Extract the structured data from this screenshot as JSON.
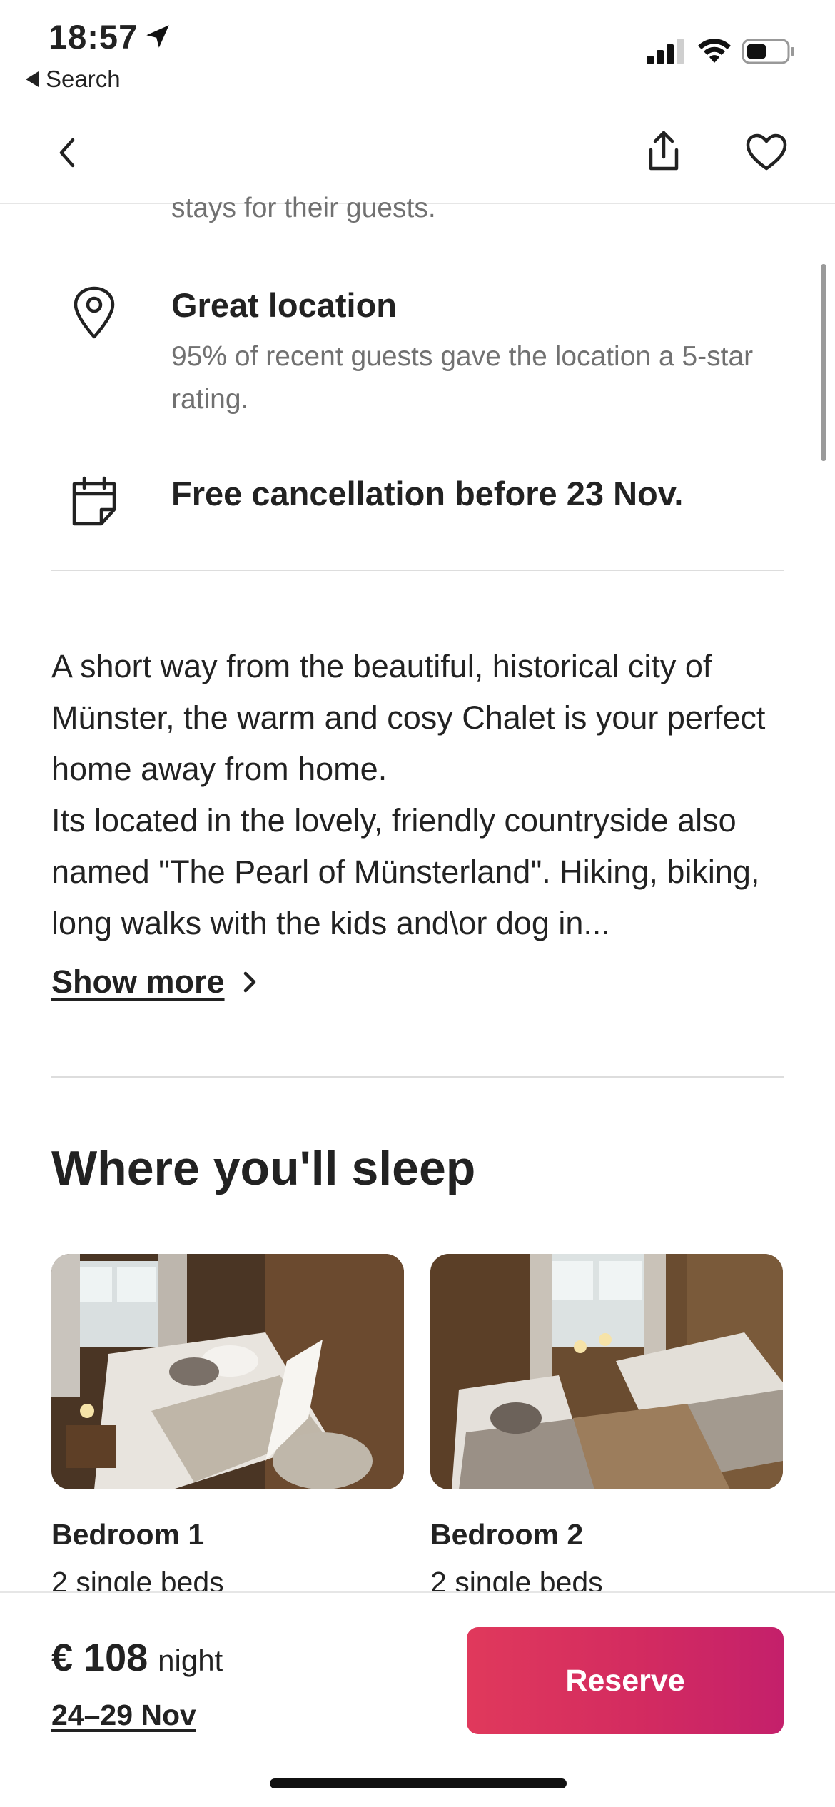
{
  "status_bar": {
    "time": "18:57",
    "back_app_label": "Search"
  },
  "highlights": {
    "partial_text": "stays for their guests.",
    "items": [
      {
        "icon": "location-pin-icon",
        "title": "Great location",
        "description": "95% of recent guests gave the location a 5-star rating."
      },
      {
        "icon": "calendar-icon",
        "title": "Free cancellation before 23 Nov.",
        "description": ""
      }
    ]
  },
  "description": {
    "paragraph1": "A short way from the beautiful, historical city of Münster, the warm and cosy Chalet is your perfect home away from home.",
    "paragraph2": "Its located in the lovely, friendly countryside also named \"The Pearl of Münsterland\". Hiking, biking, long walks with the kids and\\or dog in...",
    "show_more_label": "Show more"
  },
  "sleep_section": {
    "title": "Where you'll sleep",
    "bedrooms": [
      {
        "name": "Bedroom 1",
        "beds": "2 single beds"
      },
      {
        "name": "Bedroom 2",
        "beds": "2 single beds"
      }
    ]
  },
  "footer": {
    "price": "€ 108",
    "per": "night",
    "dates": "24–29 Nov",
    "reserve_label": "Reserve"
  },
  "colors": {
    "accent": "#dd3d5c",
    "text": "#222222",
    "muted": "#717171",
    "divider": "#dddddd"
  }
}
